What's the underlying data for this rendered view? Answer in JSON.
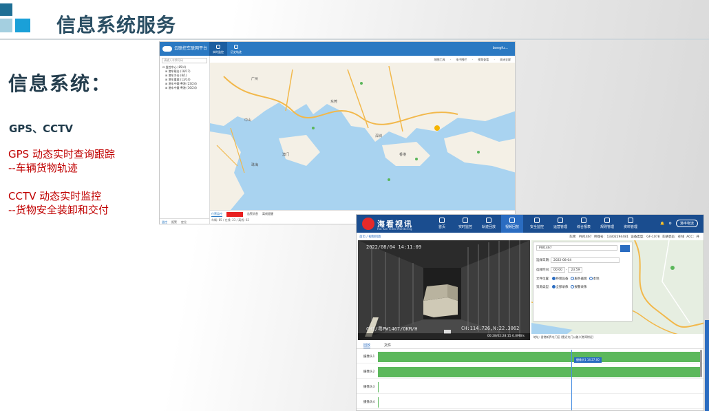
{
  "slide": {
    "title": "信息系统服务",
    "section_heading": "信息系统：",
    "subheading": "GPS、CCTV",
    "gps_line1": "GPS 动态实时查询跟踪",
    "gps_line2": "--车辆货物轨迹",
    "cctv_line1": "CCTV 动态实时监控",
    "cctv_line2": "--货物安全装卸和交付",
    "accent_color": "#c00000",
    "title_color": "#2a4e63"
  },
  "platform": {
    "brand": "云联控车联网平台",
    "nav": [
      "实时监控",
      "历史轨迹"
    ],
    "user": "bongfu...",
    "search_placeholder": "请输入车牌号码",
    "tree": [
      "监控中心 (85/4)",
      "港车载仓 (18/17)",
      "港车冷仓 (8/1)",
      "港车重载 (13/14)",
      "港车中载·粤港 (23/24)",
      "港车中重·粤港 (16/24)"
    ],
    "toolbar": "地图工具 · 电子围栏 · 视频查看 · 关闭全屏",
    "map_labels": [
      "东莞",
      "深圳",
      "香港",
      "澳门",
      "珠海",
      "中山",
      "广州"
    ],
    "bottom_tabs": [
      "位置监控",
      "报警",
      "告警消息",
      "离线提醒"
    ],
    "side_tabs": [
      "监控",
      "报警",
      "定位"
    ],
    "status": "车辆: 85 / 在线: 23 / 离线: 62"
  },
  "video_app": {
    "brand": "海看视讯",
    "brand_sub": "Hai Kan Video Monitoring",
    "nav": [
      "首页",
      "实时监控",
      "轨迹回放",
      "视频回放",
      "安全监控",
      "运营管理",
      "综合报表",
      "规则管理",
      "资料管理"
    ],
    "active_nav": "视频回放",
    "company": "港丰物流",
    "breadcrumb": "首页 / 视频回放",
    "vehicle_info": "车牌: PW1467 终端号: 13302294481 设备类型: GF-1078 车辆状态: 在线 ACC: 开",
    "osd_date": "2022/08/04 14:11:09",
    "osd_name": "CH1/粤PW1467/OKM/H",
    "osd_coords": "CH:114.726,N:22.3062",
    "video_status": "00:28/02:28:15 0.0MB/s",
    "form": {
      "plate": "PW1467",
      "date_label": "选择日期:",
      "date": "2022-08-04",
      "time_label": "选择时间:",
      "time_from": "00:00",
      "time_to": "23:59",
      "loc_label": "文件位置:",
      "loc_options": [
        "终端设备",
        "服务器端",
        "本地",
        "磁盘"
      ],
      "type_label": "资源类型:",
      "type_options": [
        "全部录像",
        "报警录像"
      ]
    },
    "address": "地址: 香港新界屯门区 (靠近屯门公路) (港湾附近)",
    "tabs": [
      "回放",
      "文件"
    ],
    "channels": [
      "摄像头1",
      "摄像头2",
      "摄像头3",
      "摄像头4"
    ],
    "channel_coverage": [
      1.0,
      1.0,
      0.0,
      0.0
    ],
    "tooltip": "摄像头1 14:27:00"
  }
}
